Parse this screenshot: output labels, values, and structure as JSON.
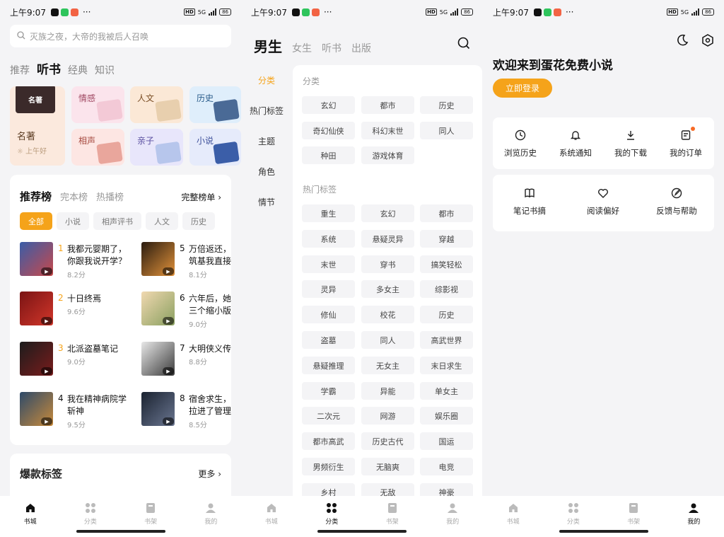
{
  "status": {
    "time": "上午9:07",
    "net": "5G",
    "battery": "86",
    "hd": "HD"
  },
  "panel1": {
    "search_placeholder": "灭族之夜，大帝的我被后人召唤",
    "tabs": [
      "推荐",
      "听书",
      "经典",
      "知识"
    ],
    "featured": {
      "cover_text": "名著",
      "name": "名著",
      "sub": "上午好"
    },
    "categories": [
      "情感",
      "人文",
      "历史",
      "相声",
      "亲子",
      "小说"
    ],
    "rank": {
      "tabs": [
        "推荐榜",
        "完本榜",
        "热播榜"
      ],
      "more": "完整榜单 ›",
      "chips": [
        "全部",
        "小说",
        "相声评书",
        "人文",
        "历史"
      ],
      "books": [
        {
          "num": "1",
          "title": "我都元婴期了，你跟我说开学？",
          "score": "8.2分"
        },
        {
          "num": "2",
          "title": "十日终焉",
          "score": "9.6分"
        },
        {
          "num": "3",
          "title": "北派盗墓笔记",
          "score": "9.0分"
        },
        {
          "num": "4",
          "title": "我在精神病院学斩神",
          "score": "9.5分"
        },
        {
          "num": "5",
          "title": "万倍返还，筑基我直接",
          "score": "8.1分"
        },
        {
          "num": "6",
          "title": "六年后，她三个缩小版",
          "score": "9.0分"
        },
        {
          "num": "7",
          "title": "大明侠义传",
          "score": "8.8分"
        },
        {
          "num": "8",
          "title": "宿舍求生，拉进了管理",
          "score": "8.5分"
        }
      ]
    },
    "hot": {
      "title": "爆款标签",
      "more": "更多 ›"
    }
  },
  "panel2": {
    "tabs": [
      "男生",
      "女生",
      "听书",
      "出版"
    ],
    "side": [
      "分类",
      "热门标签",
      "主题",
      "角色",
      "情节"
    ],
    "sec1": "分类",
    "cats": [
      "玄幻",
      "都市",
      "历史",
      "奇幻仙侠",
      "科幻末世",
      "同人",
      "种田",
      "游戏体育"
    ],
    "sec2": "热门标签",
    "tags": [
      "重生",
      "玄幻",
      "都市",
      "系统",
      "悬疑灵异",
      "穿越",
      "末世",
      "穿书",
      "搞笑轻松",
      "灵异",
      "多女主",
      "综影视",
      "修仙",
      "校花",
      "历史",
      "盗墓",
      "同人",
      "高武世界",
      "悬疑推理",
      "无女主",
      "末日求生",
      "学霸",
      "异能",
      "单女主",
      "二次元",
      "网游",
      "娱乐圈",
      "都市高武",
      "历史古代",
      "国运",
      "男频衍生",
      "无脑爽",
      "电竞",
      "乡村",
      "无敌",
      "神豪"
    ]
  },
  "panel3": {
    "welcome": "欢迎来到蛋花免费小说",
    "login": "立即登录",
    "row1": [
      "浏览历史",
      "系统通知",
      "我的下载",
      "我的订单"
    ],
    "row2": [
      "笔记书摘",
      "阅读偏好",
      "反馈与帮助"
    ]
  },
  "nav": [
    "书城",
    "分类",
    "书架",
    "我的"
  ],
  "colors": {
    "accent": "#f5a31a",
    "bg": "#f4f4f6"
  }
}
